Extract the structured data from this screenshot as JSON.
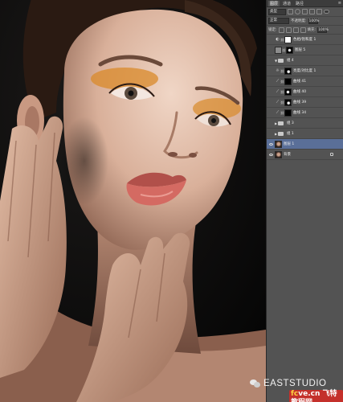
{
  "panel": {
    "tabs": [
      "图层",
      "通道",
      "路径"
    ],
    "kind_select": "类型",
    "blend_mode": "正常",
    "opacity_label": "不透明度:",
    "opacity_value": "100%",
    "lock_label": "锁定:",
    "fill_label": "填充:",
    "fill_value": "100%",
    "layers": [
      {
        "name": "色相/饱和度 1",
        "type": "adjust",
        "visible": false,
        "mask": "white"
      },
      {
        "name": "图层 5",
        "type": "pixel",
        "visible": false,
        "thumb": "grey",
        "mask": "spot"
      },
      {
        "name": "组 4",
        "type": "group",
        "visible": false
      },
      {
        "name": "亮度/对比度 1",
        "type": "adjust",
        "visible": false,
        "mask": "spot2"
      },
      {
        "name": "曲线 41",
        "type": "adjust",
        "visible": false,
        "mask": "black"
      },
      {
        "name": "曲线 40",
        "type": "adjust",
        "visible": false,
        "mask": "spot"
      },
      {
        "name": "曲线 39",
        "type": "adjust",
        "visible": false,
        "mask": "spot2"
      },
      {
        "name": "曲线 34",
        "type": "adjust",
        "visible": false,
        "mask": "black"
      },
      {
        "name": "组 3",
        "type": "group",
        "visible": false
      },
      {
        "name": "组 1",
        "type": "group",
        "visible": false
      },
      {
        "name": "图层 1",
        "type": "pixel",
        "visible": true,
        "thumb": "photo",
        "selected": true
      },
      {
        "name": "背景",
        "type": "background",
        "visible": true,
        "thumb": "photo"
      }
    ]
  },
  "watermark": {
    "brand": "EASTSTUDIO",
    "site_prefix": "fc",
    "site_rest": "ve.cn",
    "site_cn": "飞特教程网"
  }
}
